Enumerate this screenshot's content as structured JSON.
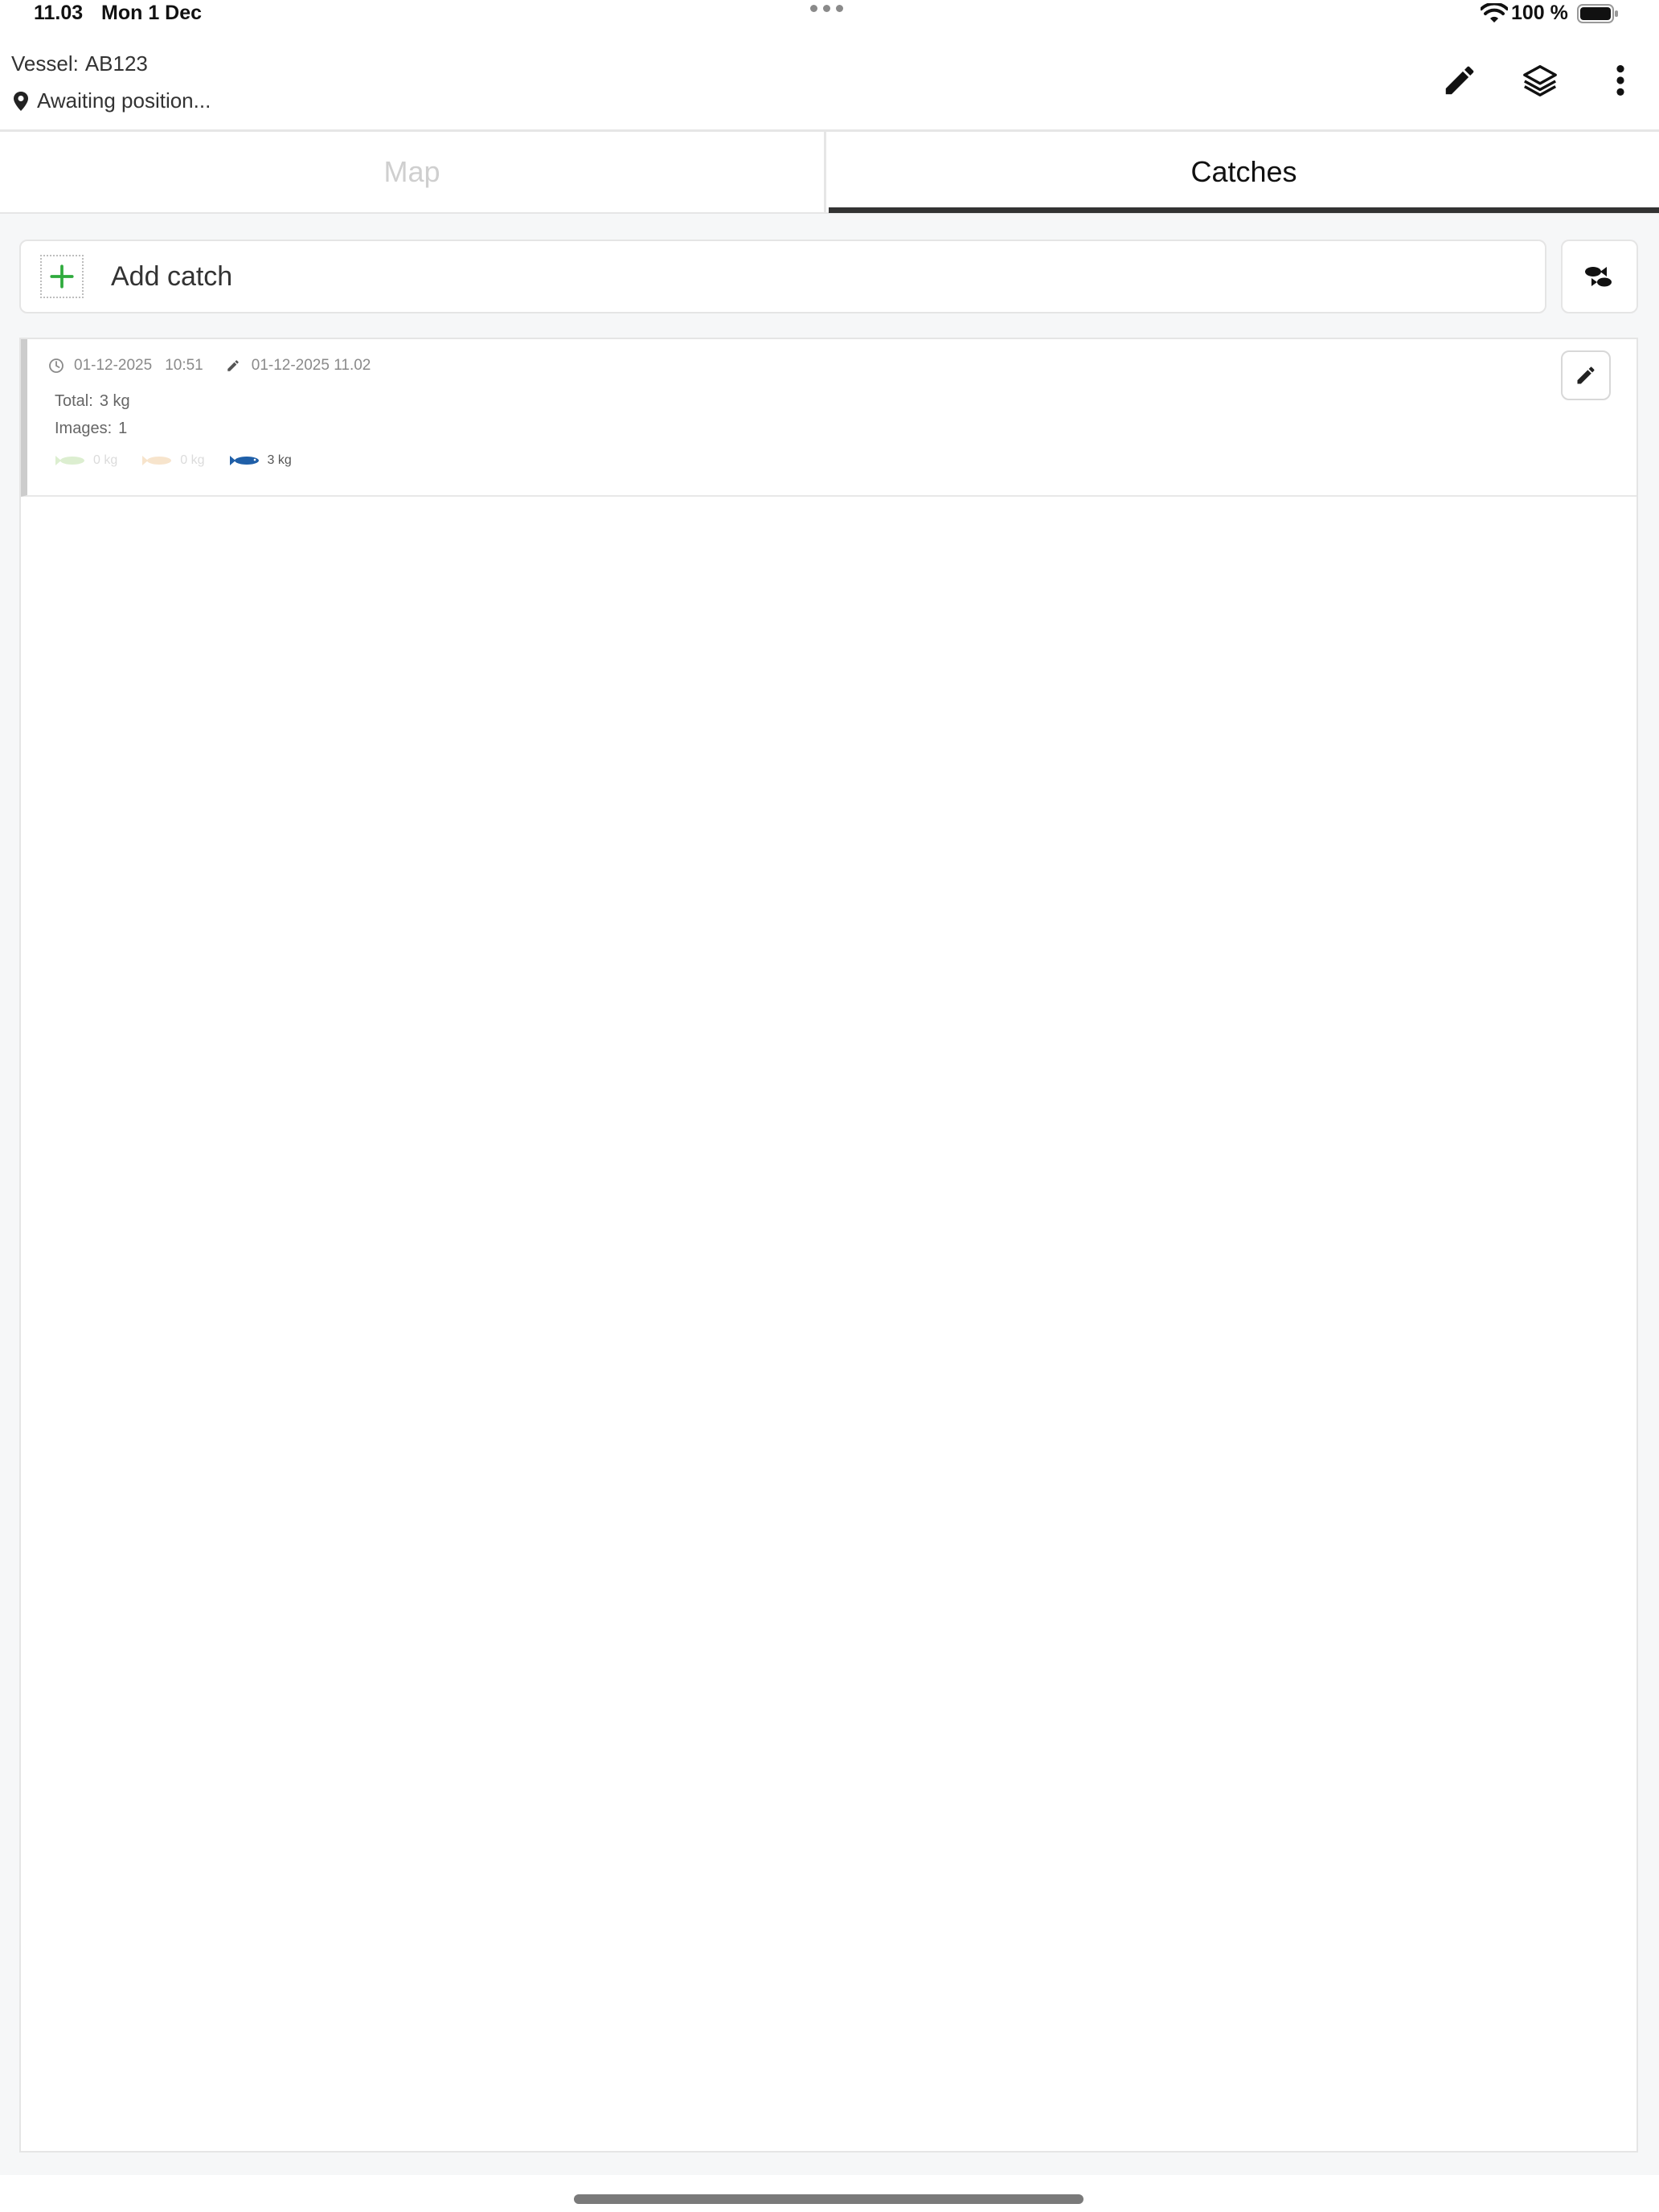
{
  "status_bar": {
    "time": "11.03",
    "date": "Mon 1 Dec",
    "battery_percent": "100 %"
  },
  "header": {
    "vessel_label": "Vessel:",
    "vessel_id": "AB123",
    "position_status": "Awaiting position...",
    "icons": [
      "pencil-icon",
      "layers-icon",
      "more-vertical-icon"
    ]
  },
  "tabs": [
    {
      "label": "Map",
      "active": false
    },
    {
      "label": "Catches",
      "active": true
    }
  ],
  "add_catch": {
    "label": "Add catch",
    "icon": "plus-icon"
  },
  "filter_button": {
    "icon": "fish-filter-icon"
  },
  "catches": [
    {
      "created_date": "01-12-2025",
      "created_time": "10:51",
      "edited": "01-12-2025 11.02",
      "total_label": "Total:",
      "total_value": "3 kg",
      "images_label": "Images:",
      "images_value": "1",
      "species": [
        {
          "icon": "fish-green-icon",
          "weight": "0 kg",
          "color": "#9ccf7a"
        },
        {
          "icon": "fish-orange-icon",
          "weight": "0 kg",
          "color": "#e9b36f"
        },
        {
          "icon": "fish-blue-icon",
          "weight": "3 kg",
          "color": "#1f5fa8"
        }
      ]
    }
  ],
  "colors": {
    "accent_green": "#2eaa3c",
    "tab_underline": "#333333",
    "divider": "#e6e6e6"
  }
}
